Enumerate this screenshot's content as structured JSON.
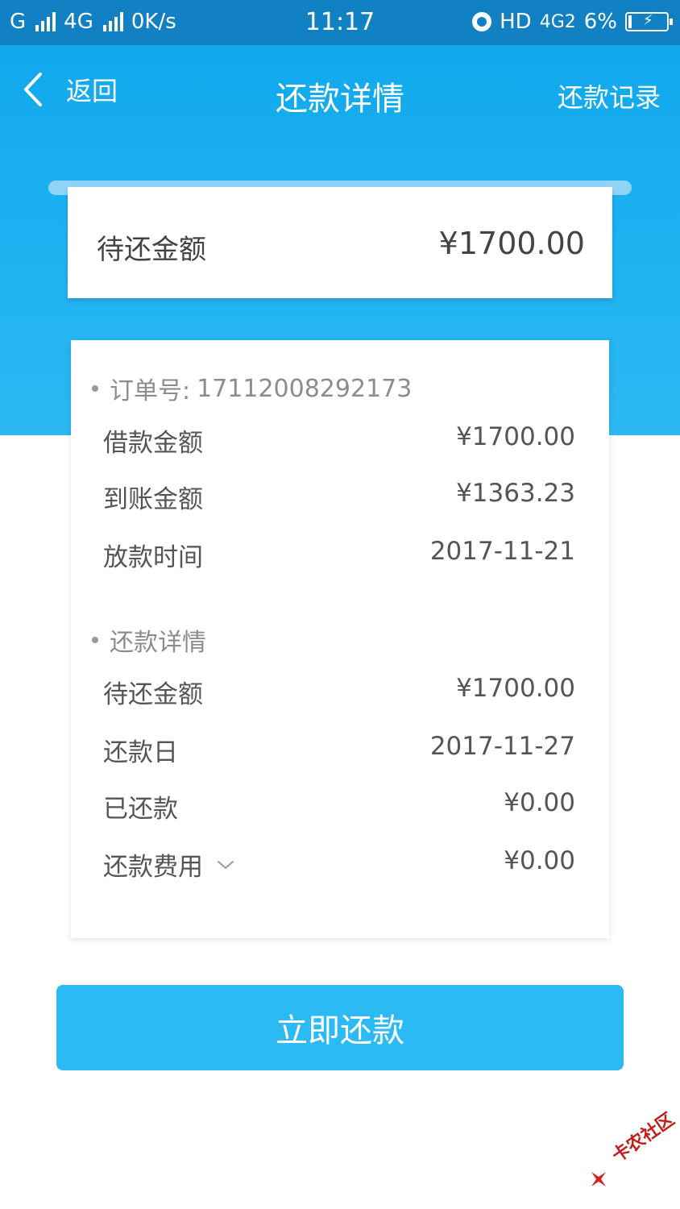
{
  "status_bar": {
    "carrier1": "G",
    "carrier2": "4G",
    "speed": "0K/s",
    "time": "11:17",
    "hd": "HD",
    "network": "4G2",
    "battery": "6%"
  },
  "nav": {
    "back_label": "返回",
    "title": "还款详情",
    "action_label": "还款记录"
  },
  "amount_card": {
    "label": "待还金额",
    "value": "¥1700.00"
  },
  "order_section": {
    "title": "订单号:",
    "order_number": "17112008292173",
    "rows": [
      {
        "label": "借款金额",
        "value": "¥1700.00"
      },
      {
        "label": "到账金额",
        "value": "¥1363.23"
      },
      {
        "label": "放款时间",
        "value": "2017-11-21"
      }
    ]
  },
  "repay_section": {
    "title": "还款详情",
    "rows": [
      {
        "label": "待还金额",
        "value": "¥1700.00"
      },
      {
        "label": "还款日",
        "value": "2017-11-27"
      },
      {
        "label": "已还款",
        "value": "¥0.00"
      },
      {
        "label": "还款费用",
        "value": "¥0.00"
      }
    ]
  },
  "repay_button": {
    "label": "立即还款"
  },
  "watermark": {
    "text": "卡农社区"
  },
  "colors": {
    "header_blue": "#19aff0",
    "status_bar_blue": "#1281c4",
    "button_blue": "#2bbaf3"
  }
}
